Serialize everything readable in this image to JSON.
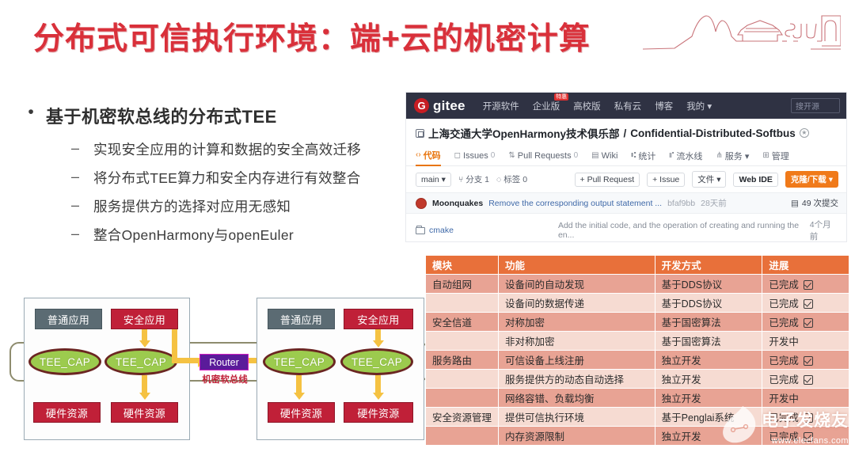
{
  "slide": {
    "title": "分布式可信执行环境：端+云的机密计算",
    "logo_name": "sjtu-campus-logo"
  },
  "bullets": {
    "level1": "基于机密软总线的分布式TEE",
    "level1_marker": "•",
    "level2_marker": "–",
    "level2": [
      "实现安全应用的计算和数据的安全高效迁移",
      "将分布式TEE算力和安全内存进行有效整合",
      "服务提供方的选择对应用无感知",
      "整合OpenHarmony与openEuler"
    ]
  },
  "diagram": {
    "normal_app": "普通应用",
    "secure_app": "安全应用",
    "tee_cap": "TEE_CAP",
    "hw_resource": "硬件资源",
    "router": "Router",
    "bus_label": "机密软总线"
  },
  "gitee": {
    "logo_mark": "G",
    "logo_text": "gitee",
    "nav": [
      {
        "label": "开源软件",
        "badge": ""
      },
      {
        "label": "企业版",
        "badge": "特惠"
      },
      {
        "label": "高校版",
        "badge": ""
      },
      {
        "label": "私有云",
        "badge": ""
      },
      {
        "label": "博客",
        "badge": ""
      },
      {
        "label": "我的 ▾",
        "badge": ""
      }
    ],
    "search_placeholder": "搜开源",
    "repo_owner": "上海交通大学OpenHarmony技术俱乐部",
    "repo_sep": "/",
    "repo_name": "Confidential-Distributed-Softbus",
    "star_icon": "★",
    "tabs": [
      {
        "icon": "‹›",
        "label": "代码",
        "count": "",
        "active": true
      },
      {
        "icon": "◻",
        "label": "Issues",
        "count": "0",
        "active": false
      },
      {
        "icon": "⇅",
        "label": "Pull Requests",
        "count": "0",
        "active": false
      },
      {
        "icon": "▤",
        "label": "Wiki",
        "count": "",
        "active": false
      },
      {
        "icon": "⑆",
        "label": "统计",
        "count": "",
        "active": false
      },
      {
        "icon": "⑈",
        "label": "流水线",
        "count": "",
        "active": false
      },
      {
        "icon": "⋔",
        "label": "服务 ▾",
        "count": "",
        "active": false
      },
      {
        "icon": "⊞",
        "label": "管理",
        "count": "",
        "active": false
      }
    ],
    "toolbar": {
      "branch": "main ▾",
      "branches": "分支 1",
      "branches_icon": "⑂",
      "tags": "标签 0",
      "tags_icon": "◌",
      "pull_request": "+ Pull Request",
      "issue": "+ Issue",
      "files": "文件 ▾",
      "web_ide": "Web IDE",
      "clone": "克隆/下载 ▾"
    },
    "commit": {
      "author": "Moonquakes",
      "message": "Remove the corresponding output statement ...",
      "hash": "bfaf9bb",
      "when": "28天前",
      "count_icon": "▤",
      "count": "49 次提交"
    },
    "file_row": {
      "name": "cmake",
      "message": "Add the initial code, and the operation of creating and running the en...",
      "when": "4个月前"
    }
  },
  "table": {
    "headers": [
      "模块",
      "功能",
      "开发方式",
      "进展"
    ],
    "rows": [
      {
        "module": "自动组网",
        "feature": "设备间的自动发现",
        "method": "基于DDS协议",
        "progress": "已完成",
        "done": true
      },
      {
        "module": "",
        "feature": "设备间的数据传递",
        "method": "基于DDS协议",
        "progress": "已完成",
        "done": true
      },
      {
        "module": "安全信道",
        "feature": "对称加密",
        "method": "基于国密算法",
        "progress": "已完成",
        "done": true
      },
      {
        "module": "",
        "feature": "非对称加密",
        "method": "基于国密算法",
        "progress": "开发中",
        "done": false
      },
      {
        "module": "服务路由",
        "feature": "可信设备上线注册",
        "method": "独立开发",
        "progress": "已完成",
        "done": true
      },
      {
        "module": "",
        "feature": "服务提供方的动态自动选择",
        "method": "独立开发",
        "progress": "已完成",
        "done": true
      },
      {
        "module": "",
        "feature": "网络容错、负载均衡",
        "method": "独立开发",
        "progress": "开发中",
        "done": false
      },
      {
        "module": "安全资源管理",
        "feature": "提供可信执行环境",
        "method": "基于Penglai系统",
        "progress": "已完成",
        "done": true
      },
      {
        "module": "",
        "feature": "内存资源限制",
        "method": "独立开发",
        "progress": "已完成",
        "done": true
      }
    ]
  },
  "watermark": {
    "cn": "电子发烧友",
    "url": "www.elecfans.com"
  },
  "colors": {
    "title_red": "#d9303a",
    "gitee_navy": "#2f3243",
    "gitee_red": "#c71d23",
    "gitee_orange": "#e8740c",
    "table_header": "#e8703a",
    "table_row_dark": "#e8a394",
    "table_row_light": "#f6dbd2",
    "node_secure": "#c02038",
    "node_normal": "#5b6b73",
    "node_cap": "#9ccb4e",
    "router_purple": "#5a1b9a",
    "arrow_yellow": "#f5c242"
  }
}
